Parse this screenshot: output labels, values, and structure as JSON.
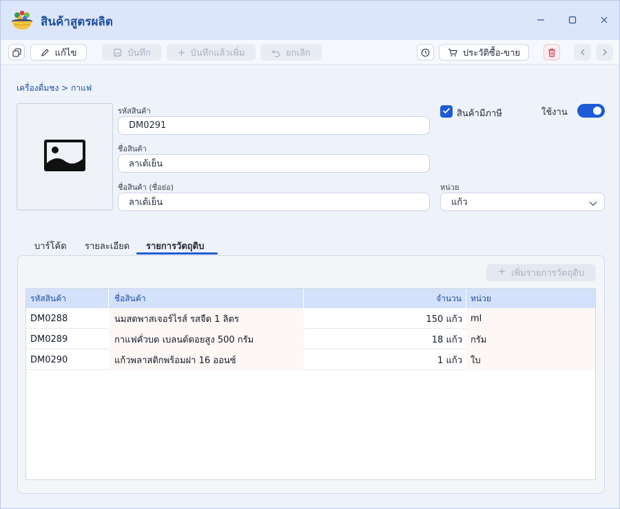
{
  "window": {
    "title": "สินค้าสูตรผลิต",
    "controls": [
      "minimize",
      "maximize",
      "close"
    ]
  },
  "toolbar": {
    "copy_label": "",
    "edit_label": "แก้ไข",
    "save_label": "บันทึก",
    "save_add_label": "บันทึกแล้วเพิ่ม",
    "cancel_label": "ยกเลิก",
    "history_label": "ประวัติซื้อ-ขาย"
  },
  "breadcrumb": "เครื่องดื่มชง > กาแฟ",
  "form": {
    "code_label": "รหัสสินค้า",
    "code_value": "DM0291",
    "name_label": "ชื่อสินค้า",
    "name_value": "ลาเต้เย็น",
    "short_name_label": "ชื่อสินค้า (ชื่อย่อ)",
    "short_name_value": "ลาเต้เย็น",
    "taxable_label": "สินค้ามีภาษี",
    "taxable_checked": true,
    "active_label": "ใช้งาน",
    "active_on": true,
    "unit_label": "หน่วย",
    "unit_value": "แก้ว"
  },
  "tabs": [
    {
      "label": "บาร์โค้ด",
      "active": false
    },
    {
      "label": "รายละเอียด",
      "active": false
    },
    {
      "label": "รายการวัตถุดิบ",
      "active": true
    }
  ],
  "materials": {
    "add_label": "เพิ่มรายการวัตถุดิบ",
    "columns": [
      "รหัสสินค้า",
      "ชื่อสินค้า",
      "จำนวน",
      "หน่วย"
    ],
    "rows": [
      {
        "code": "DM0288",
        "name": "นมสดพาสเจอร์ไรส์ รสจืด 1 ลิตร",
        "qty": "150 แก้ว",
        "unit": "ml"
      },
      {
        "code": "DM0289",
        "name": "กาแฟคั่วบด เบลนด์ดอยสูง 500 กรัม",
        "qty": "18 แก้ว",
        "unit": "กรัม"
      },
      {
        "code": "DM0290",
        "name": "แก้วพลาสติกพร้อมฝา 16 ออนซ์",
        "qty": "1 แก้ว",
        "unit": "ใบ"
      }
    ]
  },
  "colors": {
    "accent": "#1d5bd6",
    "title": "#1d4f9e",
    "titlebar_bg": "#dce6fb",
    "grid_header_bg": "#d4e1fb"
  }
}
